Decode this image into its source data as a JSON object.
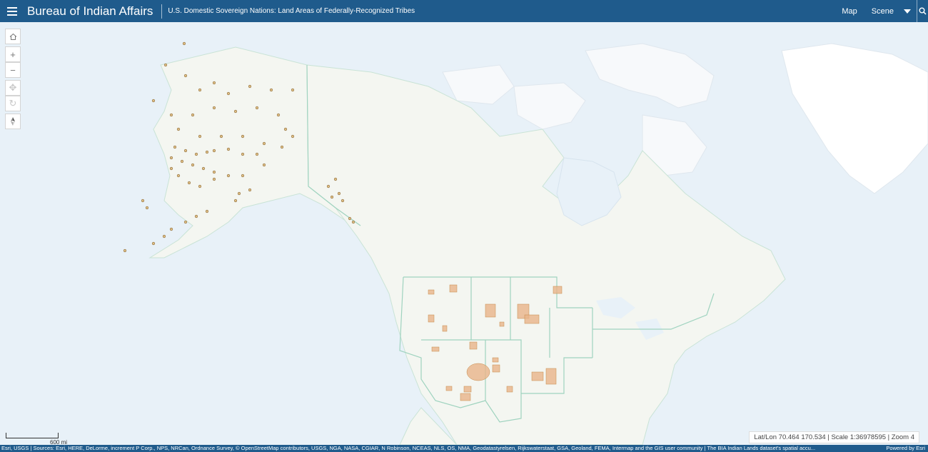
{
  "header": {
    "title": "Bureau of Indian Affairs",
    "subtitle": "U.S. Domestic Sovereign Nations: Land Areas of Federally-Recognized Tribes",
    "map_label": "Map",
    "scene_label": "Scene"
  },
  "icons": {
    "menu": "hamburger-icon",
    "search": "search-icon",
    "home": "home-icon",
    "zoom_in": "plus-icon",
    "zoom_out": "minus-icon",
    "pan": "pan-icon",
    "rotate": "rotate-icon",
    "compass": "compass-icon"
  },
  "map": {
    "scale_label": "600 mi",
    "status": "Lat/Lon 70.464 170.534 | Scale 1:36978595 | Zoom 4",
    "attribution": "Esri, USGS | Sources: Esri, HERE, DeLorme, increment P Corp., NPS, NRCan, Ordnance Survey, © OpenStreetMap contributors, USGS, NGA, NASA, CGIAR, N Robinson, NCEAS, NLS, OS, NMA, Geodatastyrelsen, Rijkswaterstaat, GSA, Geoland, FEMA, Intermap and the GIS user community | The BIA Indian Lands dataset's spatial accu...",
    "powered_by": "Powered by Esri"
  },
  "colors": {
    "header": "#1f5b8c",
    "ocean": "#e8f1f8",
    "land": "#f4f6f1",
    "ice": "#ffffff",
    "border": "#9fd3bf",
    "tribal_land": "#e8b48a",
    "tribal_point": "#c48a4a"
  }
}
